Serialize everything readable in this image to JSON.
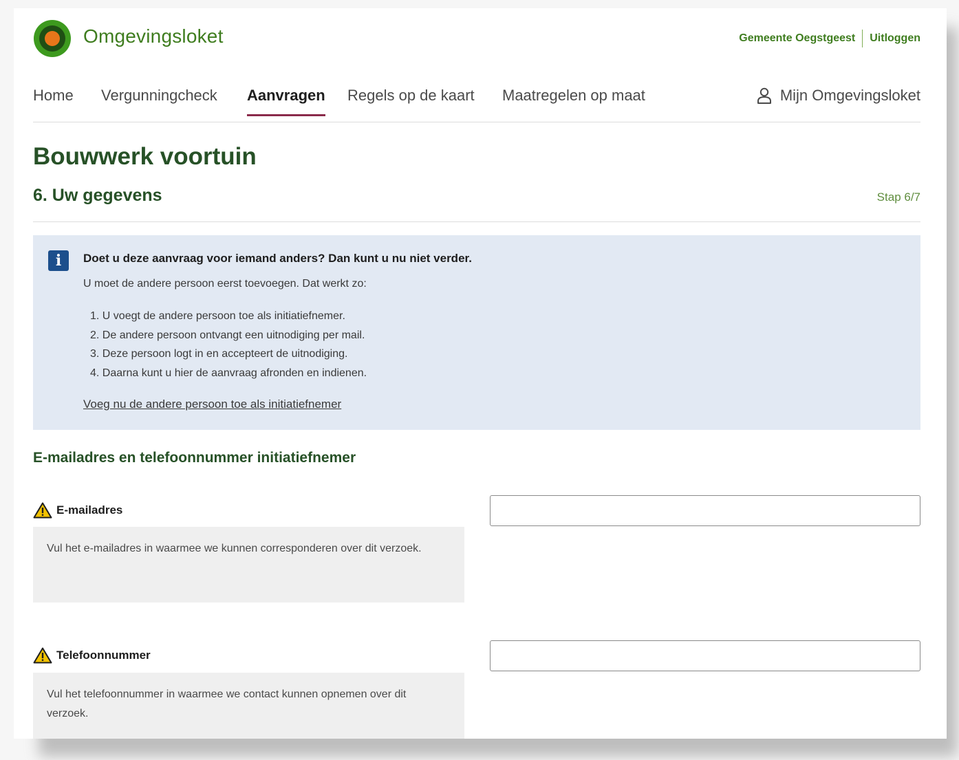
{
  "header": {
    "brand": "Omgevingsloket",
    "municipality_link": "Gemeente Oegstgeest",
    "logout_link": "Uitloggen"
  },
  "nav": {
    "items": [
      {
        "label": "Home"
      },
      {
        "label": "Vergunningcheck"
      },
      {
        "label": "Aanvragen",
        "active": true
      },
      {
        "label": "Regels op de kaart"
      },
      {
        "label": "Maatregelen op maat"
      }
    ],
    "account_label": "Mijn Omgevingsloket"
  },
  "page": {
    "title": "Bouwwerk voortuin",
    "step_title": "6. Uw gegevens",
    "step_counter": "Stap 6/7"
  },
  "info_box": {
    "heading": "Doet u deze aanvraag voor iemand anders? Dan kunt u nu niet verder.",
    "intro": "U moet de andere persoon eerst toevoegen. Dat werkt zo:",
    "steps": [
      "1. U voegt de andere persoon toe als initiatiefnemer.",
      "2. De andere persoon ontvangt een uitnodiging per mail.",
      "3. Deze persoon logt in en accepteert de uitnodiging.",
      "4. Daarna kunt u hier de aanvraag afronden en indienen."
    ],
    "link": "Voeg nu de andere persoon toe als initiatiefnemer"
  },
  "contact_section": {
    "title": "E-mailadres en telefoonnummer initiatiefnemer",
    "email": {
      "label": "E-mailadres",
      "help": "Vul het e-mailadres in waarmee we kunnen corresponderen over dit verzoek.",
      "value": ""
    },
    "phone": {
      "label": "Telefoonnummer",
      "help": "Vul het telefoonnummer in waarmee we contact kunnen opnemen over dit verzoek.",
      "value": ""
    }
  },
  "colors": {
    "brand_green": "#3f7d1f",
    "title_green": "#275127",
    "active_underline": "#8a2a4a",
    "info_bg": "#e2e9f3",
    "info_icon": "#1c4f8c",
    "warning_yellow": "#f2c200"
  }
}
